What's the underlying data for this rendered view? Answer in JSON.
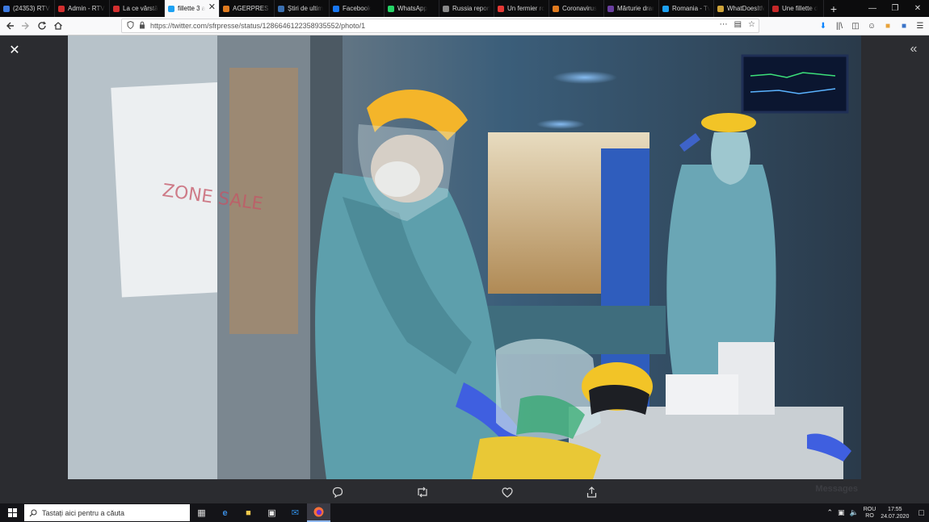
{
  "browser": {
    "tabs": [
      {
        "label": "(24353) RTV Y",
        "icon": "bell-icon",
        "color": "#3d7ae0"
      },
      {
        "label": "Admin - RTV",
        "icon": "r-logo-icon",
        "color": "#d32f2f"
      },
      {
        "label": "La ce vârstă",
        "icon": "r-logo-icon",
        "color": "#d32f2f"
      },
      {
        "label": "fillette 3 a",
        "icon": "twitter-icon",
        "color": "#1da1f2",
        "active": true
      },
      {
        "label": "AGERPRES -",
        "icon": "agerpres-icon",
        "color": "#e07b1f"
      },
      {
        "label": "Știri de ultim",
        "icon": "news-icon",
        "color": "#3a6fb0"
      },
      {
        "label": "Facebook",
        "icon": "facebook-icon",
        "color": "#1877f2"
      },
      {
        "label": "WhatsApp",
        "icon": "whatsapp-icon",
        "color": "#25d366"
      },
      {
        "label": "Russia report",
        "icon": "dots-icon",
        "color": "#888888"
      },
      {
        "label": "Un fermier rc",
        "icon": "red-circle-icon",
        "color": "#e53935"
      },
      {
        "label": "Coronavirus",
        "icon": "agerpres-icon",
        "color": "#e07b1f"
      },
      {
        "label": "Mărturie drar",
        "icon": "m-logo-icon",
        "color": "#6a3fa0"
      },
      {
        "label": "Romania - Tv",
        "icon": "twitter-icon",
        "color": "#1da1f2"
      },
      {
        "label": "WhatDoesItM",
        "icon": "bars-icon",
        "color": "#cfa43a"
      },
      {
        "label": "Une fillette d",
        "icon": "seven-icon",
        "color": "#c62828"
      }
    ],
    "active_tab_close": "✕",
    "new_tab": "+",
    "url": "https://twitter.com/sfrpresse/status/1286646122358935552/photo/1"
  },
  "viewer": {
    "close_label": "✕",
    "expand_label": "«",
    "photo_sign_text": "ZONE SALE",
    "messages_label": "Messages"
  },
  "taskbar": {
    "search_placeholder": "Tastați aici pentru a căuta",
    "lang_top": "ROU",
    "lang_bottom": "RO",
    "time": "17:55",
    "date": "24.07.2020"
  },
  "colors": {
    "accent": "#1da1f2",
    "viewer_bg": "#2b2c30",
    "taskbar_bg": "#141418"
  }
}
